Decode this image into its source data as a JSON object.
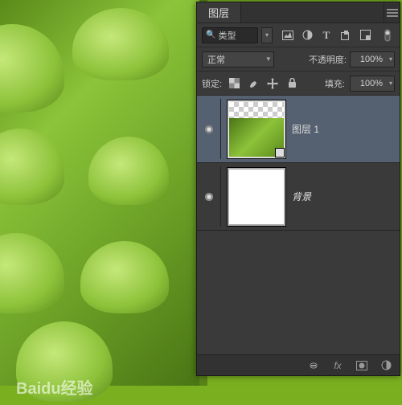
{
  "panel": {
    "title": "图层",
    "filter": {
      "label": "类型",
      "search_glyph": "🔍"
    },
    "filter_icons": [
      "image-filter-icon",
      "adjust-filter-icon",
      "type-filter-icon",
      "shape-filter-icon",
      "smart-filter-icon"
    ],
    "blend_mode": "正常",
    "opacity": {
      "label": "不透明度:",
      "value": "100%"
    },
    "lock": {
      "label": "锁定:"
    },
    "fill": {
      "label": "填充:",
      "value": "100%"
    }
  },
  "layers": [
    {
      "name": "图层 1",
      "visible": true,
      "selected": true,
      "thumb": "image"
    },
    {
      "name": "背景",
      "visible": true,
      "selected": false,
      "thumb": "white",
      "italic": true
    }
  ],
  "watermark": "Baidu经验"
}
